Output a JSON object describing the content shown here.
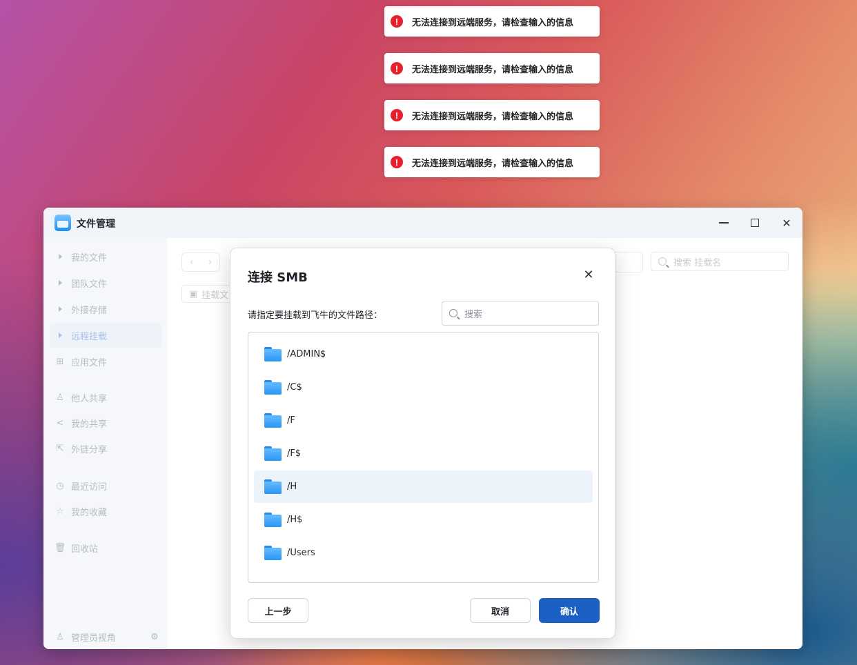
{
  "toasts": [
    {
      "text": "无法连接到远端服务，请检查输入的信息"
    },
    {
      "text": "无法连接到远端服务，请检查输入的信息"
    },
    {
      "text": "无法连接到远端服务，请检查输入的信息"
    },
    {
      "text": "无法连接到远端服务，请检查输入的信息"
    }
  ],
  "toast_icon": "!",
  "window": {
    "title": "文件管理"
  },
  "sidebar": {
    "items": [
      {
        "label": "我的文件",
        "icon": "expand-arrow-icon"
      },
      {
        "label": "团队文件",
        "icon": "expand-arrow-icon"
      },
      {
        "label": "外接存储",
        "icon": "expand-arrow-icon"
      },
      {
        "label": "远程挂载",
        "icon": "expand-arrow-icon",
        "active": true
      },
      {
        "label": "应用文件",
        "icon": "apps-icon"
      },
      {
        "label": "他人共享",
        "icon": "user-icon"
      },
      {
        "label": "我的共享",
        "icon": "share-icon"
      },
      {
        "label": "外链分享",
        "icon": "external-share-icon"
      },
      {
        "label": "最近访问",
        "icon": "clock-icon"
      },
      {
        "label": "我的收藏",
        "icon": "star-icon"
      },
      {
        "label": "回收站",
        "icon": "trash-icon"
      }
    ],
    "footer": {
      "label": "管理员视角",
      "icon": "user-icon",
      "settings_icon": "gear-icon"
    }
  },
  "content": {
    "mount_button": "挂载文",
    "search_placeholder": "搜索 挂载名"
  },
  "dialog": {
    "title": "连接 SMB",
    "prompt": "请指定要挂载到飞牛的文件路径：",
    "search_placeholder": "搜索",
    "folders": [
      {
        "name": "/ADMIN$"
      },
      {
        "name": "/C$"
      },
      {
        "name": "/F"
      },
      {
        "name": "/F$"
      },
      {
        "name": "/H",
        "selected": true
      },
      {
        "name": "/H$"
      },
      {
        "name": "/Users"
      }
    ],
    "buttons": {
      "prev": "上一步",
      "cancel": "取消",
      "confirm": "确认"
    }
  },
  "colors": {
    "accent": "#1c60c4",
    "error": "#e8202e",
    "selected_row": "#ecf3fb"
  }
}
